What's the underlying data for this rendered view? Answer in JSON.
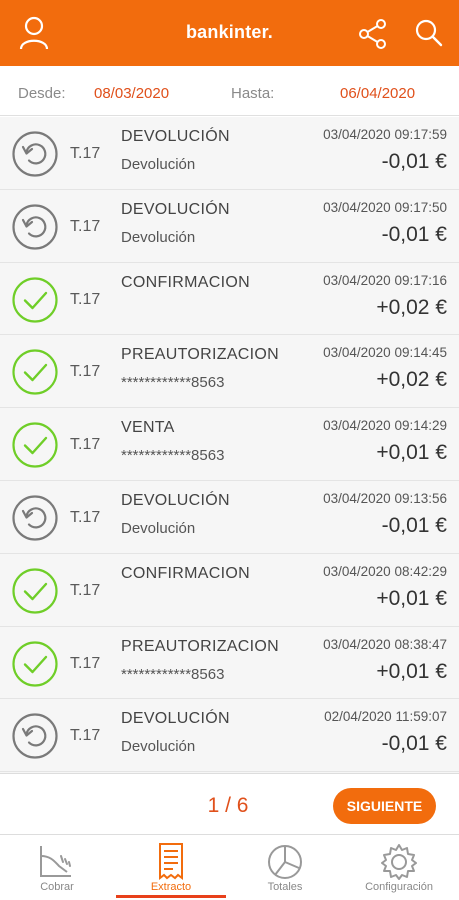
{
  "header": {
    "brand": "bankinter."
  },
  "filter": {
    "from_label": "Desde:",
    "from_value": "08/03/2020",
    "to_label": "Hasta:",
    "to_value": "06/04/2020"
  },
  "colors": {
    "accent": "#f26c0d",
    "ok_green": "#6fce28",
    "pending_gray": "#7a7a7a",
    "date_red": "#e0501b"
  },
  "transactions": [
    {
      "status": "refund",
      "terminal": "T.17",
      "type": "DEVOLUCIÓN",
      "description": "Devolución",
      "datetime": "03/04/2020 09:17:59",
      "amount": "-0,01 €"
    },
    {
      "status": "refund",
      "terminal": "T.17",
      "type": "DEVOLUCIÓN",
      "description": "Devolución",
      "datetime": "03/04/2020 09:17:50",
      "amount": "-0,01 €"
    },
    {
      "status": "ok",
      "terminal": "T.17",
      "type": "CONFIRMACION",
      "description": "",
      "datetime": "03/04/2020 09:17:16",
      "amount": "+0,02 €"
    },
    {
      "status": "ok",
      "terminal": "T.17",
      "type": "PREAUTORIZACION",
      "description": "************8563",
      "datetime": "03/04/2020 09:14:45",
      "amount": "+0,02 €"
    },
    {
      "status": "ok",
      "terminal": "T.17",
      "type": "VENTA",
      "description": "************8563",
      "datetime": "03/04/2020 09:14:29",
      "amount": "+0,01 €"
    },
    {
      "status": "refund",
      "terminal": "T.17",
      "type": "DEVOLUCIÓN",
      "description": "Devolución",
      "datetime": "03/04/2020 09:13:56",
      "amount": "-0,01 €"
    },
    {
      "status": "ok",
      "terminal": "T.17",
      "type": "CONFIRMACION",
      "description": "",
      "datetime": "03/04/2020 08:42:29",
      "amount": "+0,01 €"
    },
    {
      "status": "ok",
      "terminal": "T.17",
      "type": "PREAUTORIZACION",
      "description": "************8563",
      "datetime": "03/04/2020 08:38:47",
      "amount": "+0,01 €"
    },
    {
      "status": "refund",
      "terminal": "T.17",
      "type": "DEVOLUCIÓN",
      "description": "Devolución",
      "datetime": "02/04/2020 11:59:07",
      "amount": "-0,01 €"
    }
  ],
  "pagination": {
    "page_text": "1 / 6",
    "next_label": "SIGUIENTE"
  },
  "tabs": [
    {
      "id": "cobrar",
      "label": "Cobrar",
      "icon": "payment-terminal-icon",
      "active": false
    },
    {
      "id": "extracto",
      "label": "Extracto",
      "icon": "receipt-icon",
      "active": true
    },
    {
      "id": "totales",
      "label": "Totales",
      "icon": "pie-chart-icon",
      "active": false
    },
    {
      "id": "configuracion",
      "label": "Configuración",
      "icon": "gear-icon",
      "active": false
    }
  ]
}
